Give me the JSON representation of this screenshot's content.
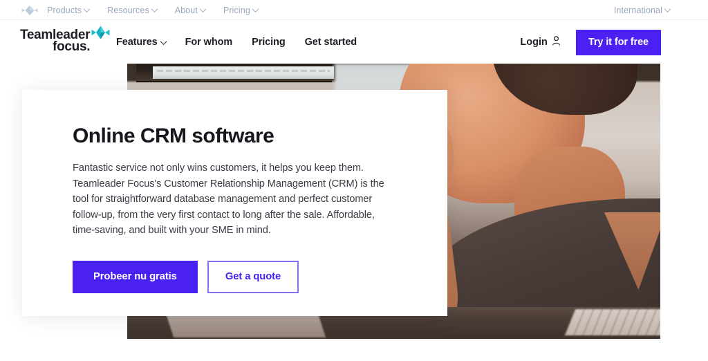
{
  "utility_bar": {
    "logo_icon": "teamleader-diamond-icon",
    "links": [
      {
        "label": "Products",
        "has_dropdown": true
      },
      {
        "label": "Resources",
        "has_dropdown": true
      },
      {
        "label": "About",
        "has_dropdown": true
      },
      {
        "label": "Pricing",
        "has_dropdown": true
      }
    ],
    "region_selector": {
      "label": "International",
      "has_dropdown": true
    },
    "text_color": "#9aa8bd"
  },
  "header": {
    "brand": {
      "line1": "Teamleader",
      "line2": "focus.",
      "mark_color": "#1fb6c6"
    },
    "nav": [
      {
        "label": "Features",
        "has_dropdown": true
      },
      {
        "label": "For whom",
        "has_dropdown": false
      },
      {
        "label": "Pricing",
        "has_dropdown": false
      },
      {
        "label": "Get started",
        "has_dropdown": false
      }
    ],
    "login": {
      "label": "Login",
      "icon": "user-icon"
    },
    "cta": {
      "label": "Try it for free",
      "color": "#4a21f2"
    }
  },
  "hero": {
    "title": "Online CRM software",
    "paragraph": "Fantastic service not only wins customers, it helps you keep them. Teamleader Focus's Customer Relationship Management (CRM) is the tool for straightforward database management and perfect customer follow-up, from the very first contact to long after the sale. Affordable, time-saving, and built with your SME in mind.",
    "primary_cta": {
      "label": "Probeer nu gratis",
      "color": "#4a21f2"
    },
    "secondary_cta": {
      "label": "Get a quote",
      "color": "#4a21f2"
    },
    "photo_alt": "Man resting chin on hand at a desk with keyboard and monitor"
  }
}
